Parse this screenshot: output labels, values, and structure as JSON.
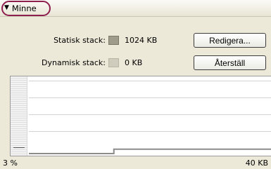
{
  "panel": {
    "title": "Minne",
    "toggle_glyph": "▼",
    "toggle_icon": "triangle-down-icon"
  },
  "static_stack": {
    "label": "Statisk stack:",
    "value": "1024 KB",
    "swatch_color": "#9f9c8c",
    "button_label": "Redigera..."
  },
  "dynamic_stack": {
    "label": "Dynamisk stack:",
    "value": "0 KB",
    "swatch_color": "#cfccbd",
    "button_label": "Återställ"
  },
  "graph": {
    "min_label": "3 %",
    "max_label": "40 KB",
    "line_color": "#8c8c8c",
    "usage_level_fraction": 0.06,
    "usage_step_fraction": 0.35
  }
}
